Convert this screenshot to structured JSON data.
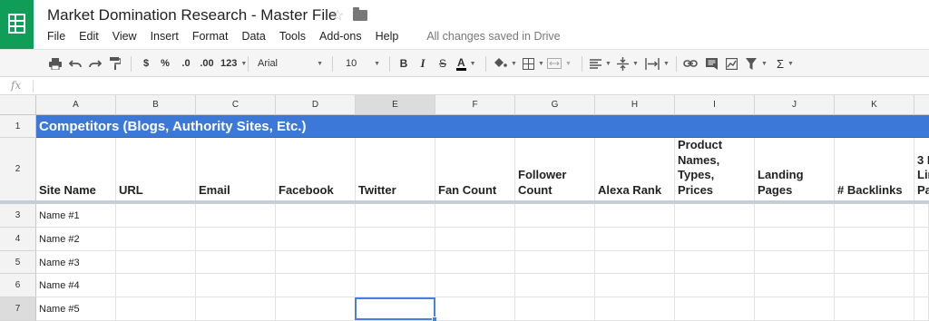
{
  "app": {
    "title": "Market Domination Research - Master File",
    "saved_status": "All changes saved in Drive"
  },
  "icons": {
    "logo": "sheets-logo-icon",
    "star": "star-icon",
    "folder": "folder-icon"
  },
  "menu": [
    "File",
    "Edit",
    "View",
    "Insert",
    "Format",
    "Data",
    "Tools",
    "Add-ons",
    "Help"
  ],
  "toolbar": {
    "currency": "$",
    "percent": "%",
    "dec_decrease": ".0",
    "dec_increase": ".00",
    "more_formats": "123",
    "font": "Arial",
    "font_size": "10",
    "bold": "B",
    "italic": "I",
    "strike": "S",
    "text_color": "A",
    "sum": "Σ"
  },
  "formula_bar": {
    "fx": "fx",
    "value": ""
  },
  "colors": {
    "accent": "#0f9d58",
    "banner": "#3c78d8",
    "selection": "#4a7fe0"
  },
  "columns": [
    "A",
    "B",
    "C",
    "D",
    "E",
    "F",
    "G",
    "H",
    "I",
    "J",
    "K"
  ],
  "rows": [
    "1",
    "2",
    "3",
    "4",
    "5",
    "6",
    "7"
  ],
  "sheet": {
    "banner": "Competitors (Blogs, Authority Sites, Etc.)",
    "headers": [
      "Site Name",
      "URL",
      "Email",
      "Facebook",
      "Twitter",
      "Fan Count",
      "Follower\nCount",
      "Alexa Rank",
      "Product\nNames,\nTypes,\nPrices",
      "Landing\nPages",
      "# Backlinks",
      "3 P\nLin\nPa"
    ],
    "names": [
      "Name #1",
      "Name #2",
      "Name #3",
      "Name #4",
      "Name #5"
    ]
  }
}
